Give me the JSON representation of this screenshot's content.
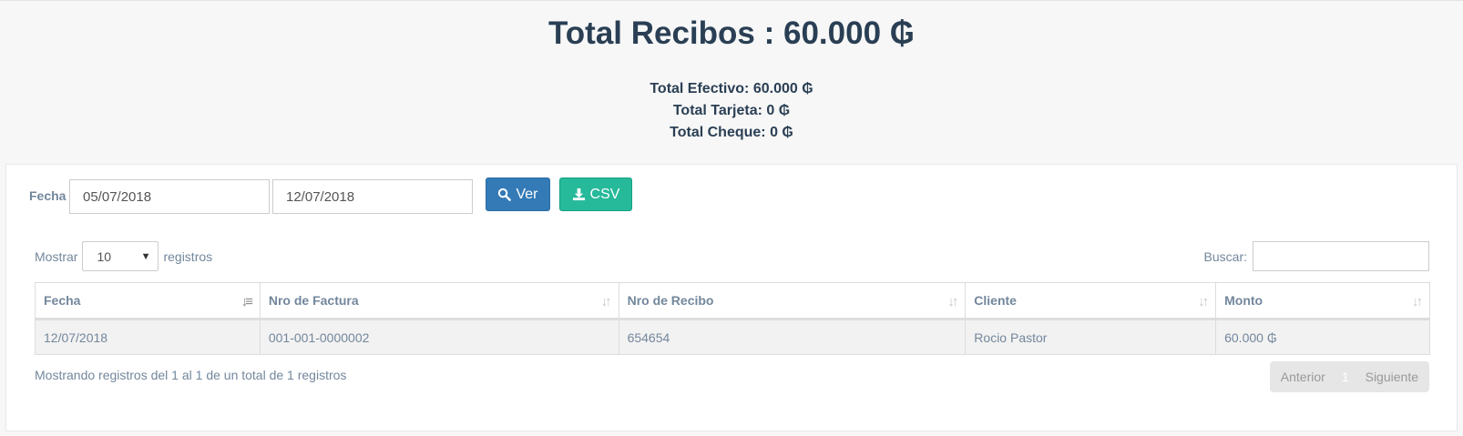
{
  "summary": {
    "title": "Total Recibos : 60.000 ₲",
    "efectivo": "Total Efectivo: 60.000 ₲",
    "tarjeta": "Total Tarjeta: 0 ₲",
    "cheque": "Total Cheque: 0 ₲"
  },
  "filter": {
    "label": "Fecha",
    "date_from": "05/07/2018",
    "date_to": "12/07/2018",
    "ver_label": "Ver",
    "csv_label": "CSV"
  },
  "table_controls": {
    "show_prefix": "Mostrar",
    "page_size": "10",
    "show_suffix": "registros",
    "search_label": "Buscar:"
  },
  "table": {
    "columns": [
      "Fecha",
      "Nro de Factura",
      "Nro de Recibo",
      "Cliente",
      "Monto"
    ],
    "rows": [
      [
        "12/07/2018",
        "001-001-0000002",
        "654654",
        "Rocio Pastor",
        "60.000 ₲"
      ]
    ]
  },
  "footer": {
    "info": "Mostrando registros del 1 al 1 de un total de 1 registros",
    "prev": "Anterior",
    "page": "1",
    "next": "Siguiente"
  },
  "colors": {
    "primary": "#337ab7",
    "success": "#26b99a",
    "heading": "#2a3f54"
  }
}
